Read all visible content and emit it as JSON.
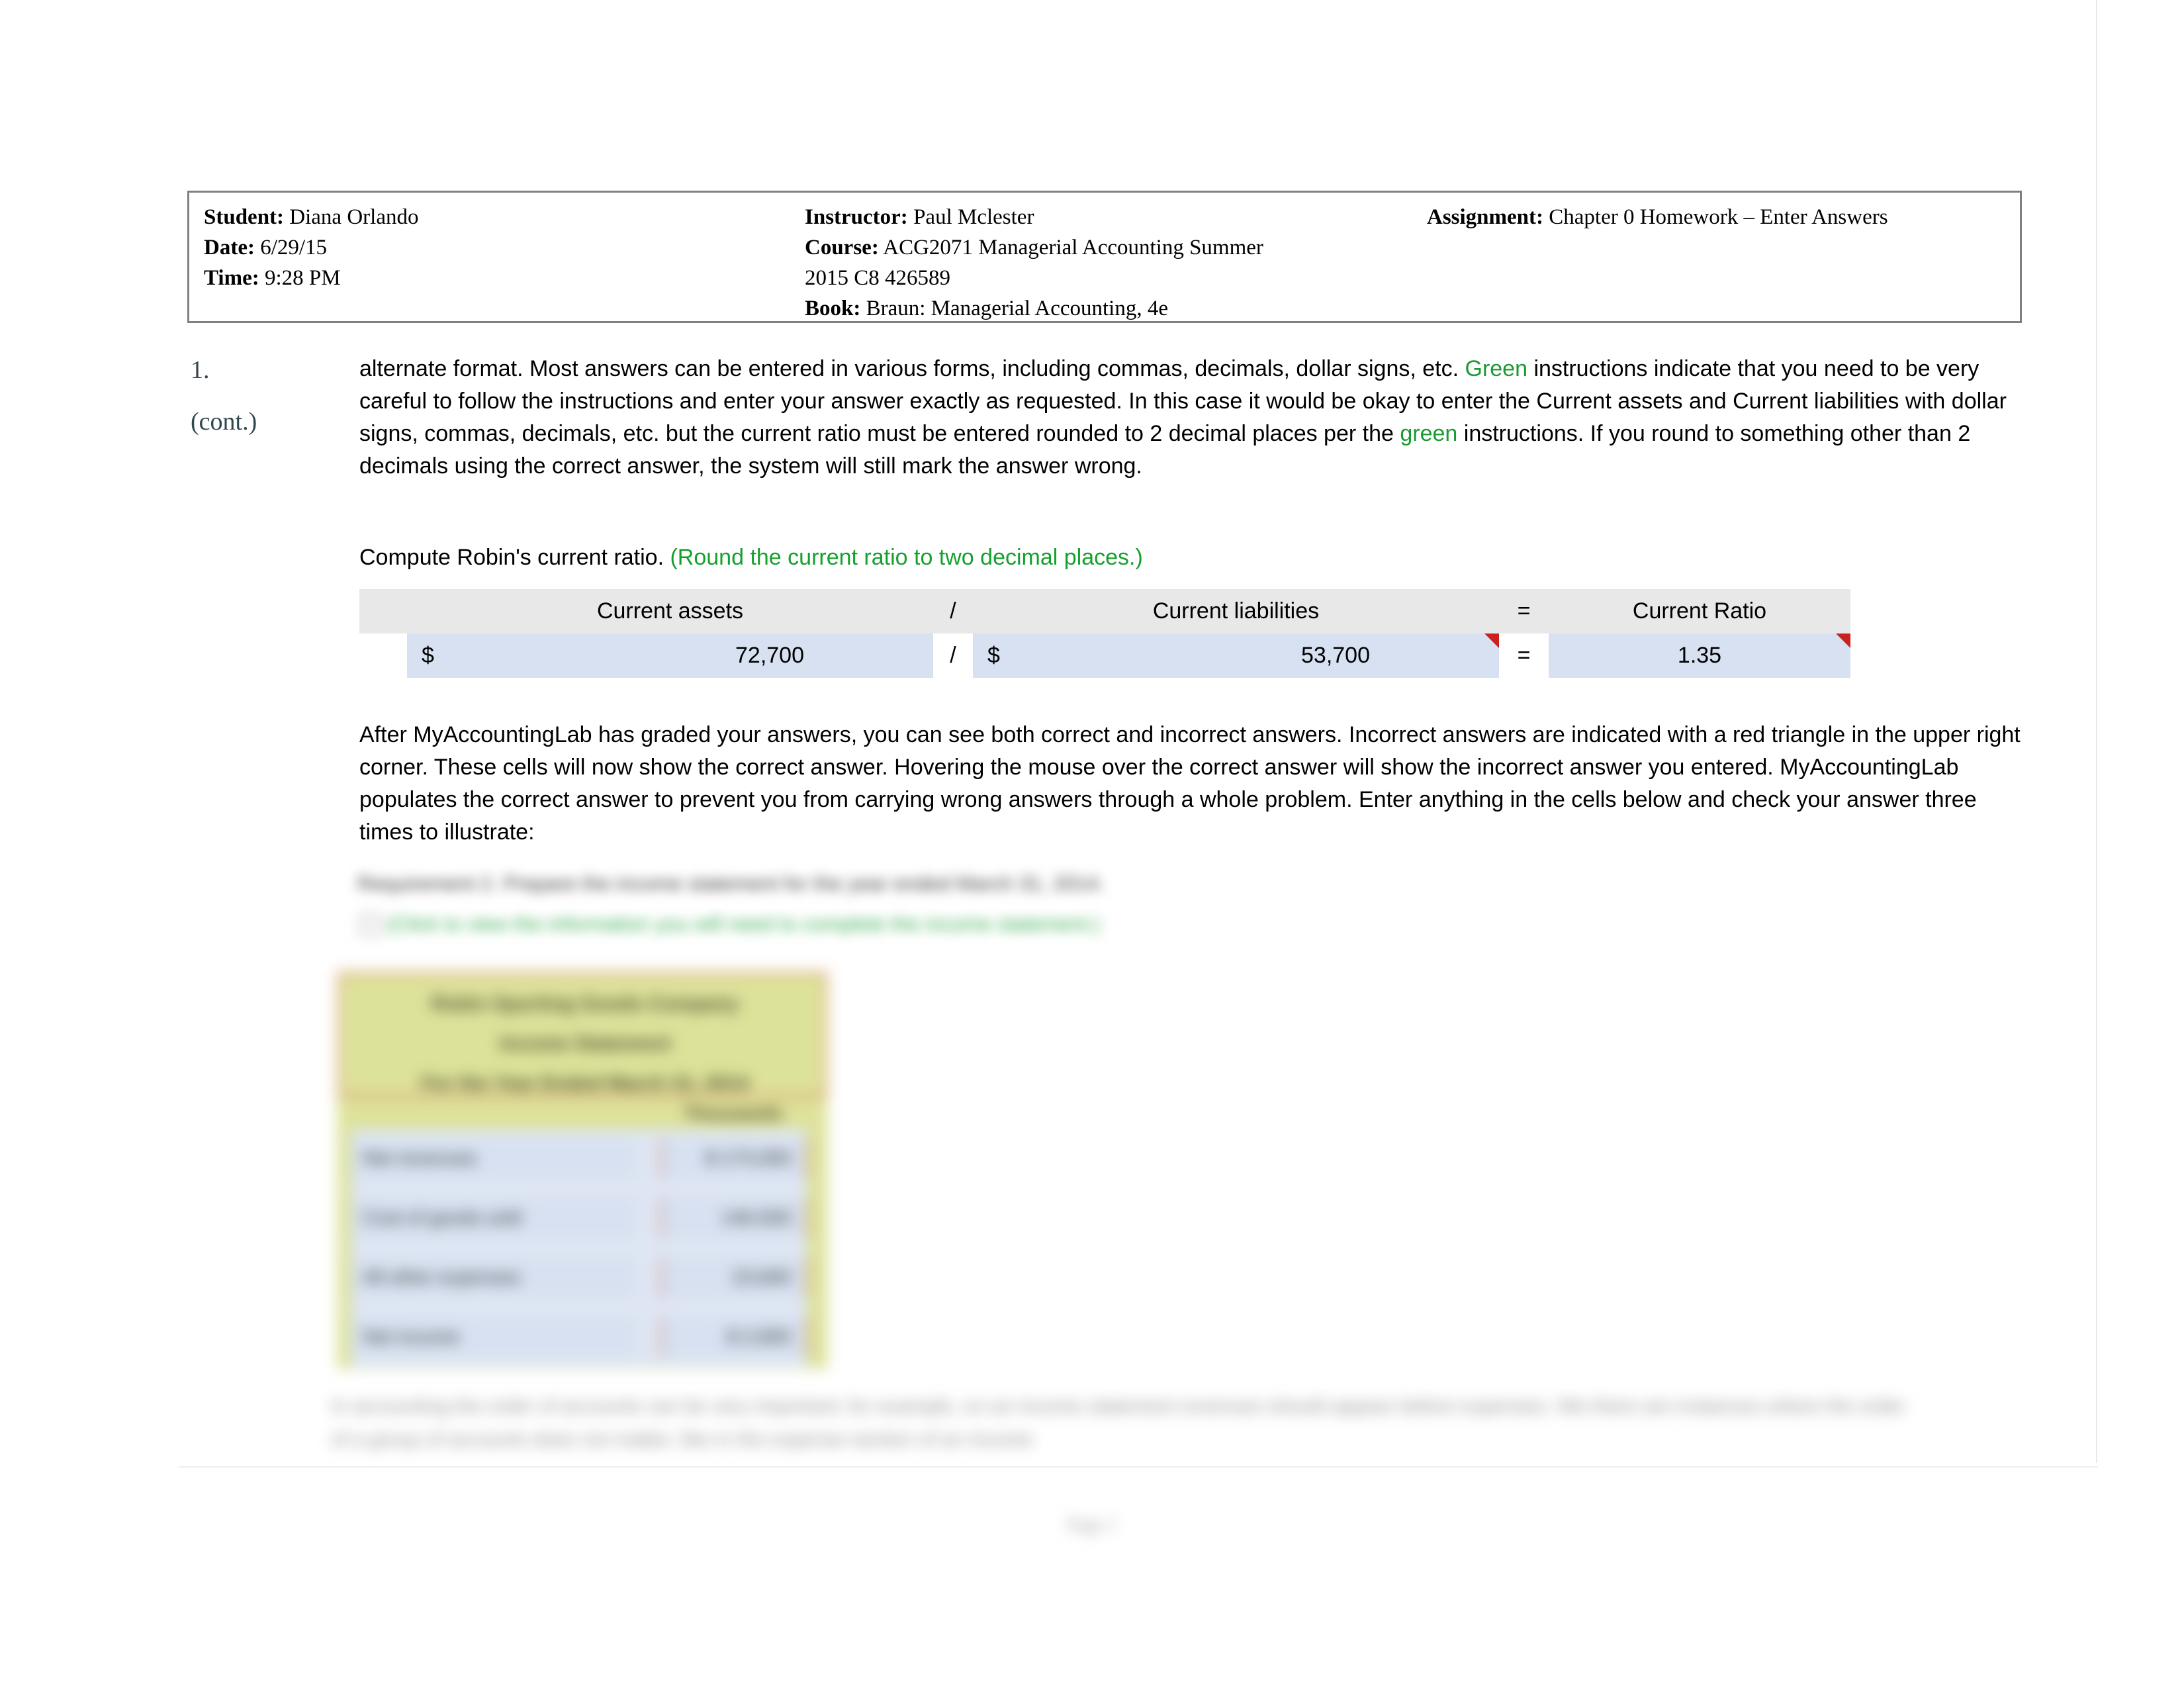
{
  "header": {
    "student_label": "Student:",
    "student_value": "Diana Orlando",
    "date_label": "Date:",
    "date_value": "6/29/15",
    "time_label": "Time:",
    "time_value": "9:28 PM",
    "instructor_label": "Instructor:",
    "instructor_value": "Paul Mclester",
    "course_label": "Course:",
    "course_value": "ACG2071 Managerial Accounting Summer",
    "course_value_line2": "2015 C8 426589",
    "book_label": "Book:",
    "book_value": "Braun: Managerial Accounting, 4e",
    "assignment_label": "Assignment:",
    "assignment_value": "Chapter 0 Homework – Enter Answers"
  },
  "gutter": {
    "question_number": "1.",
    "continued": "(cont.)"
  },
  "paragraph_1": {
    "seg1": "alternate format. Most answers can be entered in various forms, including commas, decimals, dollar signs, etc. ",
    "green1": "Green",
    "seg2": " instructions indicate that you need to be very careful to follow the instructions and enter your answer exactly as requested. In this case it would be okay to enter the Current assets and Current liabilities with dollar signs, commas, decimals, etc. but the current ratio must be entered rounded to 2 decimal places per the ",
    "green2": "green",
    "seg3": " instructions. If you round to something other than 2 decimals using the correct answer, the system will still mark the answer wrong."
  },
  "compute_line": {
    "prompt": "Compute Robin's current ratio. ",
    "instruction": "(Round the current ratio to two decimal places.)"
  },
  "ratio_table": {
    "headers": {
      "blank": "",
      "current_assets": "Current assets",
      "divide_op": "/",
      "current_liabilities": "Current liabilities",
      "equals_op": "=",
      "current_ratio": "Current Ratio"
    },
    "values": {
      "assets_symbol": "$",
      "assets_amount": "72,700",
      "divide_op": "/",
      "liabilities_symbol": "$",
      "liabilities_amount": "53,700",
      "equals_op": "=",
      "ratio_value": "1.35"
    },
    "colors": {
      "header_bg": "#e8e8e8",
      "cell_bg": "#d7e1f1",
      "wrong_marker": "#cc2020"
    },
    "wrong_answer_cells": [
      "liabilities_amount",
      "ratio_value"
    ]
  },
  "paragraph_2": {
    "text": "After MyAccountingLab has graded your answers, you can see both correct and incorrect answers. Incorrect answers are indicated with a red triangle in the upper right corner. These cells will now show the correct answer. Hovering the mouse over the correct answer will show the incorrect answer you entered. MyAccountingLab populates the correct answer to prevent you from carrying wrong answers through a whole problem. Enter anything in the cells below and check your answer three times to illustrate:"
  },
  "blurred_section": {
    "requirement_line": "Requirement 2. Prepare the income statement for the year ended March 31, 2014.",
    "green_hint_line": "(Click to view the information you will need to complete the income statement.)",
    "statement_title_1": "Robin Sporting Goods Company",
    "statement_title_2": "Income Statement",
    "statement_title_3": "For the Year Ended March 31, 2014",
    "column_header": "Thousands",
    "rows": [
      {
        "label": "Net revenues",
        "value": "$   174,000"
      },
      {
        "label": "Cost of goods sold",
        "value": "146,500"
      },
      {
        "label": "All other expenses",
        "value": "23,600"
      },
      {
        "label": "Net income",
        "value": "$    3,900"
      }
    ],
    "bottom_paragraph": "In accounting the order of accounts can be very important; for example, on an income statement revenues should appear before expenses. We there are instances where the order of a group of accounts does not matter, like in the expense section of an income"
  },
  "footer": {
    "page_label": "Page 1"
  }
}
